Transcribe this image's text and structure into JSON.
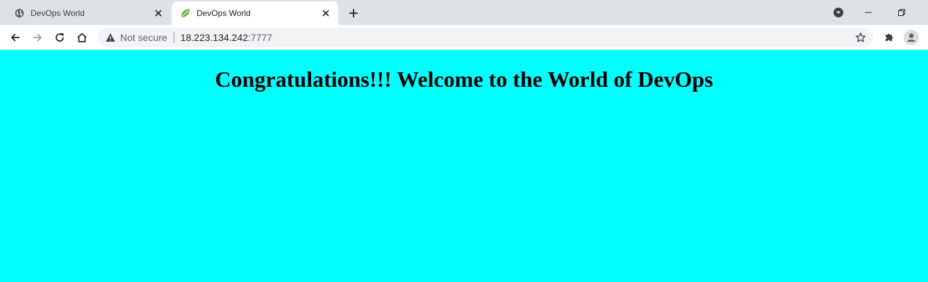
{
  "tabs": [
    {
      "title": "DevOps World",
      "favicon": "globe-icon",
      "active": false
    },
    {
      "title": "DevOps World",
      "favicon": "spring-leaf-icon",
      "active": true
    }
  ],
  "toolbar": {
    "security_label": "Not secure",
    "url_host": "18.223.134.242",
    "url_port": ":7777"
  },
  "page": {
    "heading": "Congratulations!!! Welcome to the World of DevOps",
    "background_color": "#00ffff"
  },
  "colors": {
    "tabstrip": "#dee1e6",
    "omnibox": "#f1f3f4",
    "spring_leaf": "#6db33f"
  }
}
